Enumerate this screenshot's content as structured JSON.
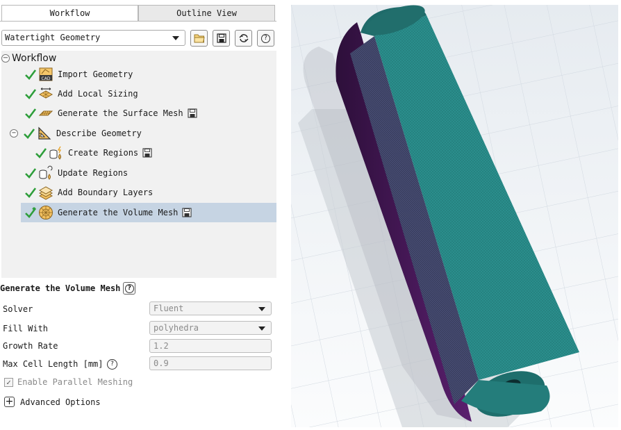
{
  "tabs": [
    {
      "label": "Workflow",
      "active": true
    },
    {
      "label": "Outline View",
      "active": false
    }
  ],
  "workflow_select": {
    "value": "Watertight Geometry"
  },
  "toolbar": {
    "icons": [
      "open-folder-icon",
      "save-icon",
      "refresh-icon",
      "help-icon"
    ]
  },
  "tree": {
    "root": "Workflow",
    "items": [
      {
        "label": "Import Geometry",
        "icon": "cad-icon",
        "status": "done"
      },
      {
        "label": "Add Local Sizing",
        "icon": "local-sizing-icon",
        "status": "done"
      },
      {
        "label": "Generate the Surface Mesh",
        "icon": "surface-mesh-icon",
        "status": "done"
      },
      {
        "label": "Describe Geometry",
        "icon": "describe-geometry-icon",
        "status": "done"
      },
      {
        "label": "Create Regions",
        "icon": "create-regions-icon",
        "status": "done"
      },
      {
        "label": "Update Regions",
        "icon": "update-regions-icon",
        "status": "done"
      },
      {
        "label": "Add Boundary Layers",
        "icon": "boundary-layers-icon",
        "status": "done"
      },
      {
        "label": "Generate the Volume Mesh",
        "icon": "volume-mesh-icon",
        "status": "done-active",
        "selected": true
      }
    ]
  },
  "properties": {
    "title": "Generate the Volume Mesh",
    "solver_label": "Solver",
    "solver_value": "Fluent",
    "fill_label": "Fill With",
    "fill_value": "polyhedra",
    "growth_label": "Growth Rate",
    "growth_value": "1.2",
    "max_cell_label": "Max Cell Length [mm]",
    "max_cell_value": "0.9",
    "parallel_label": "Enable Parallel Meshing",
    "parallel_checked": true,
    "advanced_label": "Advanced Options"
  },
  "colors": {
    "check_green": "#2e9e3b",
    "selected_row": "#c6d4e3",
    "mesh_teal": "#2a8e8c",
    "mesh_purple": "#5a1f6e",
    "mesh_dark": "#2b2f4a"
  }
}
